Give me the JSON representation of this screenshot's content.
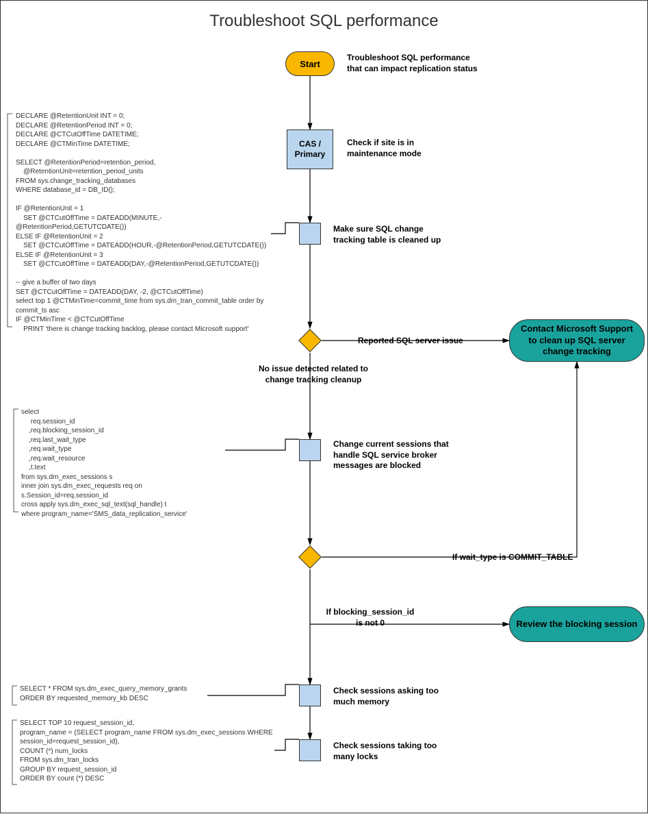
{
  "title": "Troubleshoot SQL performance",
  "nodes": {
    "start": "Start",
    "start_note": "Troubleshoot SQL performance\nthat can impact replication status",
    "cas": "CAS /\nPrimary",
    "cas_note": "Check if site is in\nmaintenance mode",
    "step2_note": "Make sure SQL change\ntracking table is cleaned up",
    "decision1_right": "Reported SQL server issue",
    "decision1_down": "No issue detected related to\nchange tracking cleanup",
    "step3_note": "Change current sessions that\nhandle SQL service broker\nmessages are blocked",
    "decision2_right": "If wait_type is COMMIT_TABLE",
    "decision2_down": "If blocking_session_id\nis not 0",
    "term1": "Contact Microsoft Support\nto clean up SQL server\nchange tracking",
    "term2": "Review the blocking session",
    "step4_note": "Check sessions asking too\nmuch memory",
    "step5_note": "Check sessions taking too\nmany locks"
  },
  "sql": {
    "block1": "DECLARE @RetentionUnit INT = 0;\nDECLARE @RetentionPeriod INT = 0;\nDECLARE @CTCutOffTime DATETIME;\nDECLARE @CTMinTime DATETIME;\n\nSELECT @RetentionPeriod=retention_period,\n    @RetentionUnit=retention_period_units\nFROM sys.change_tracking_databases\nWHERE database_id = DB_ID();\n\nIF @RetentionUnit = 1\n    SET @CTCutOffTime = DATEADD(MINUTE,-@RetentionPeriod,GETUTCDATE())\nELSE IF @RetentionUnit = 2\n    SET @CTCutOffTime = DATEADD(HOUR,-@RetentionPeriod,GETUTCDATE())\nELSE IF @RetentionUnit = 3\n    SET @CTCutOffTime = DATEADD(DAY,-@RetentionPeriod,GETUTCDATE())\n\n-- give a buffer of two days\nSET @CTCutOffTime = DATEADD(DAY, -2, @CTCutOffTime)\nselect top 1 @CTMinTime=commit_time from sys.dm_tran_commit_table order by\ncommit_ts asc\nIF @CTMinTime < @CTCutOffTime\n    PRINT 'there is change tracking backlog, please contact Microsoft support'",
    "block2": "select\n     req.session_id\n    ,req.blocking_session_id\n    ,req.last_wait_type\n    ,req.wait_type\n    ,req.wait_resource\n    ,t.text\nfrom sys.dm_exec_sessions s\ninner join sys.dm_exec_requests req on s.Session_id=req.session_id\ncross apply sys.dm_exec_sql_text(sql_handle) t\nwhere program_name='SMS_data_replication_service'",
    "block3": "SELECT * FROM sys.dm_exec_query_memory_grants\nORDER BY requested_memory_kb DESC",
    "block4": "SELECT TOP 10 request_session_id,\nprogram_name = (SELECT program_name FROM sys.dm_exec_sessions WHERE\nsession_id=request_session_id),\nCOUNT (*) num_locks\nFROM sys.dm_tran_locks\nGROUP BY request_session_id\nORDER BY count (*) DESC"
  }
}
